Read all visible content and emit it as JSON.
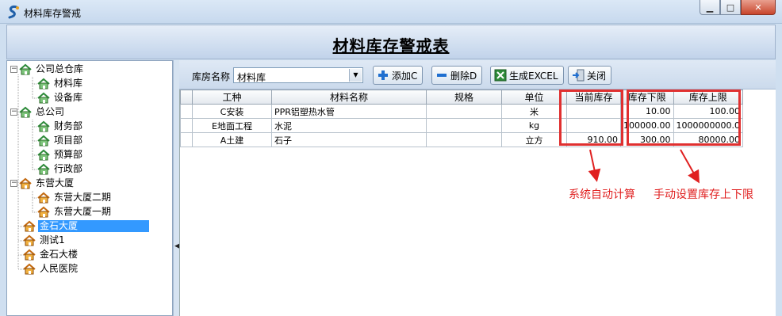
{
  "window": {
    "title": "材料库存警戒",
    "minimize": "▁",
    "maximize": "□",
    "close": "✕"
  },
  "report": {
    "title": "材料库存警戒表"
  },
  "tree": {
    "items": [
      {
        "label": "公司总仓库",
        "expander": "−"
      },
      {
        "label": "材料库"
      },
      {
        "label": "设备库"
      },
      {
        "label": "总公司",
        "expander": "−"
      },
      {
        "label": "财务部"
      },
      {
        "label": "项目部"
      },
      {
        "label": "预算部"
      },
      {
        "label": "行政部"
      },
      {
        "label": "东营大厦",
        "expander": "−"
      },
      {
        "label": "东营大厦二期"
      },
      {
        "label": "东营大厦一期"
      },
      {
        "label": "金石大厦"
      },
      {
        "label": "测试1"
      },
      {
        "label": "金石大楼"
      },
      {
        "label": "人民医院"
      }
    ]
  },
  "toolbar": {
    "warehouse_label": "库房名称",
    "warehouse_value": "材料库",
    "add": "添加C",
    "delete": "删除D",
    "excel": "生成EXCEL",
    "close": "关闭"
  },
  "grid": {
    "columns": [
      "工种",
      "材料名称",
      "规格",
      "单位",
      "当前库存",
      "库存下限",
      "库存上限"
    ],
    "rows": [
      {
        "type": "C安装",
        "name": "PPR铝塑热水管",
        "spec": "",
        "unit": "米",
        "stock": "",
        "min": "10.00",
        "max": "100.00"
      },
      {
        "type": "E地面工程",
        "name": "水泥",
        "spec": "",
        "unit": "kg",
        "stock": "",
        "min": "100000.00",
        "max": "1000000000.0"
      },
      {
        "type": "A土建",
        "name": "石子",
        "spec": "",
        "unit": "立方",
        "stock": "910.00",
        "min": "300.00",
        "max": "80000.00"
      }
    ]
  },
  "annotations": {
    "auto_calc": "系统自动计算",
    "manual_limits": "手动设置库存上下限",
    "color": "#e02020"
  }
}
